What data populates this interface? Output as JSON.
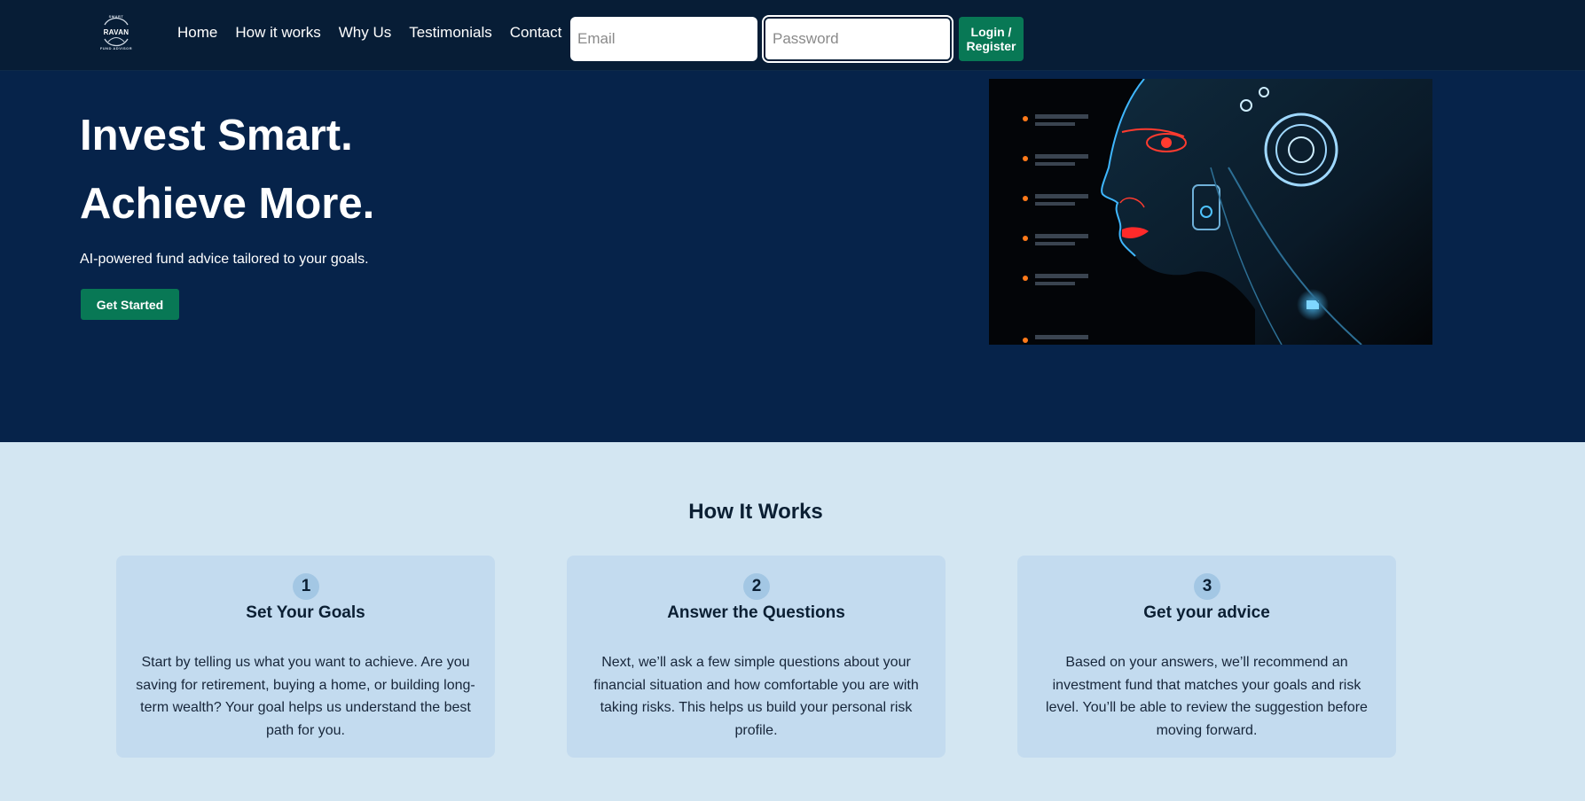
{
  "header": {
    "logo": {
      "top_text": "SMART",
      "name": "RAVAN",
      "bottom_text": "FUND ADVISOR"
    },
    "nav": [
      {
        "label": "Home"
      },
      {
        "label": "How it works"
      },
      {
        "label": "Why Us"
      },
      {
        "label": "Testimonials"
      },
      {
        "label": "Contact"
      }
    ],
    "email": {
      "placeholder": "Email",
      "value": ""
    },
    "password": {
      "placeholder": "Password",
      "value": ""
    },
    "login_button": {
      "line1": "Login /",
      "line2": "Register"
    }
  },
  "hero": {
    "title_line1": "Invest Smart.",
    "title_line2": "Achieve More.",
    "subtitle": "AI-powered fund advice tailored to your goals.",
    "cta_label": "Get Started"
  },
  "how_it_works": {
    "title": "How It Works",
    "steps": [
      {
        "number": "1",
        "title": "Set Your Goals",
        "text": "Start by telling us what you want to achieve. Are you saving for retirement, buying a home, or building long-term wealth? Your goal helps us understand the best path for you."
      },
      {
        "number": "2",
        "title": "Answer the Questions",
        "text": "Next, we’ll ask a few simple questions about your financial situation and how comfortable you are with taking risks. This helps us build your personal risk profile."
      },
      {
        "number": "3",
        "title": "Get your advice",
        "text": "Based on your answers, we’ll recommend an investment fund that matches your goals and risk level. You’ll be able to review the suggestion before moving forward."
      }
    ]
  },
  "colors": {
    "header_bg": "#071d36",
    "hero_bg": "#06234a",
    "accent_green": "#087855",
    "section_bg": "#d3e6f2",
    "card_bg": "#c3dbef"
  }
}
